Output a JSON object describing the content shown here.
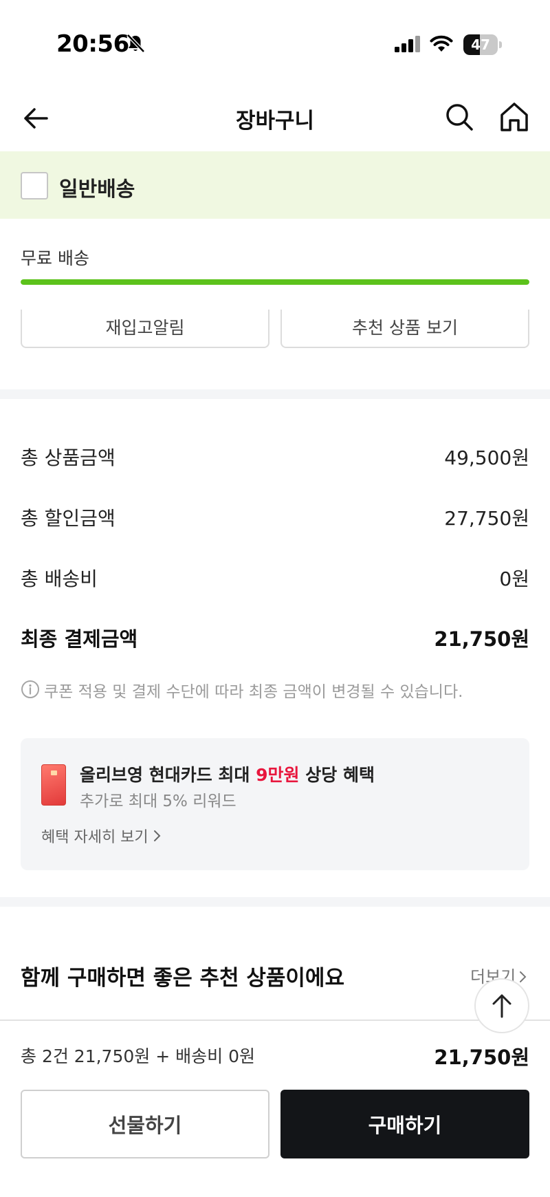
{
  "status_bar": {
    "time": "20:56",
    "battery_percent": "47",
    "battery_level": 0.47,
    "icons": [
      "bell-muted-icon",
      "cellular-signal-icon",
      "wifi-icon",
      "battery-icon"
    ]
  },
  "header": {
    "title": "장바구니",
    "icons": [
      "back-arrow-icon",
      "search-icon",
      "home-icon"
    ]
  },
  "delivery": {
    "label": "일반배송",
    "checked": false,
    "free_shipping_label": "무료 배송",
    "free_shipping_progress": 1.0
  },
  "actions": {
    "restock_alert": "재입고알림",
    "view_recommended": "추천 상품 보기"
  },
  "summary": {
    "rows": [
      {
        "label": "총 상품금액",
        "value": "49,500원"
      },
      {
        "label": "총 할인금액",
        "value": "27,750원"
      },
      {
        "label": "총 배송비",
        "value": "0원"
      }
    ],
    "final_label": "최종 결제금액",
    "final_value": "21,750원",
    "notice": "쿠폰 적용 및 결제 수단에 따라 최종 금액이 변경될 수 있습니다."
  },
  "promo": {
    "title_prefix": "올리브영 현대카드 최대 ",
    "title_highlight": "9만원",
    "title_suffix": " 상당 혜택",
    "subtitle": "추가로 최대 5% 리워드",
    "link": "혜택 자세히 보기",
    "highlight_color": "#e8163d"
  },
  "recommend": {
    "title": "함께 구매하면 좋은 추천 상품이에요",
    "more": "더보기"
  },
  "bottom": {
    "summary": "총 2건 21,750원 + 배송비 0원",
    "total": "21,750원",
    "gift_button": "선물하기",
    "buy_button": "구매하기"
  },
  "colors": {
    "accent_green": "#5cc21b",
    "delivery_bg": "#f0f8e1",
    "buy_button_bg": "#131518"
  }
}
